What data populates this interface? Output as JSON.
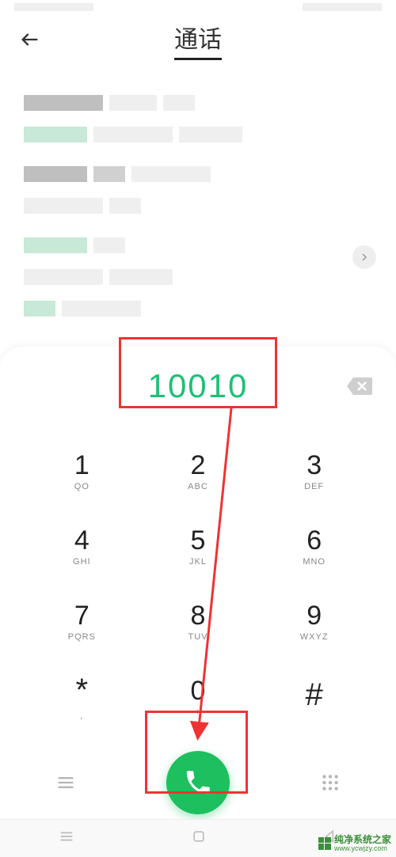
{
  "header": {
    "title": "通话"
  },
  "dialer": {
    "number": "10010",
    "keys": [
      {
        "digit": "1",
        "letters": "QO"
      },
      {
        "digit": "2",
        "letters": "ABC"
      },
      {
        "digit": "3",
        "letters": "DEF"
      },
      {
        "digit": "4",
        "letters": "GHI"
      },
      {
        "digit": "5",
        "letters": "JKL"
      },
      {
        "digit": "6",
        "letters": "MNO"
      },
      {
        "digit": "7",
        "letters": "PQRS"
      },
      {
        "digit": "8",
        "letters": "TUV"
      },
      {
        "digit": "9",
        "letters": "WXYZ"
      },
      {
        "digit": "*",
        "letters": ","
      },
      {
        "digit": "0",
        "letters": "+"
      },
      {
        "digit": "#",
        "letters": ""
      }
    ]
  },
  "watermark": {
    "line1": "纯净系统之家",
    "line2": "www.ycwjzy.com"
  }
}
